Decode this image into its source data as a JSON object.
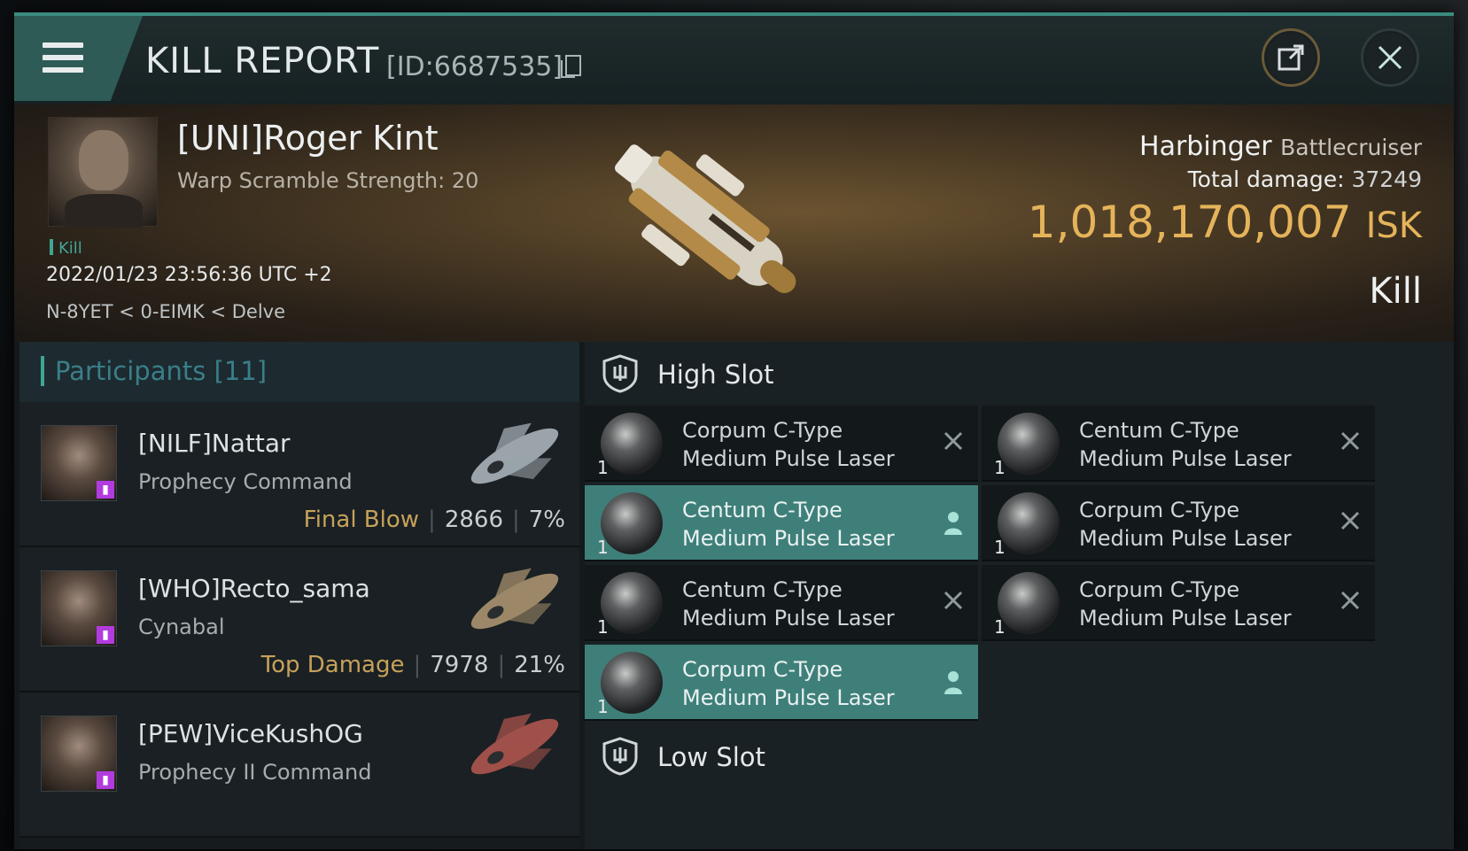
{
  "header": {
    "title": "KILL REPORT",
    "id_label": "[ID:6687535]"
  },
  "victim": {
    "name": "[UNI]Roger Kint",
    "subtitle": "Warp Scramble Strength: 20",
    "kill_tag": "Kill",
    "date": "2022/01/23 23:56:36 UTC +2",
    "location": "N-8YET < 0-EIMK < Delve"
  },
  "ship": {
    "name": "Harbinger",
    "class": "Battlecruiser",
    "total_damage_label": "Total damage:",
    "total_damage": "37249",
    "value": "1,018,170,007",
    "currency": "ISK",
    "result": "Kill"
  },
  "participants": {
    "label": "Participants [11]",
    "rows": [
      {
        "name": "[NILF]Nattar",
        "ship": "Prophecy Command",
        "tag": "Final Blow",
        "damage": "2866",
        "percent": "7%",
        "ship_color": "#9aa4aa"
      },
      {
        "name": "[WHO]Recto_sama",
        "ship": "Cynabal",
        "tag": "Top Damage",
        "damage": "7978",
        "percent": "21%",
        "ship_color": "#9c8868"
      },
      {
        "name": "[PEW]ViceKushOG",
        "ship": "Prophecy II Command",
        "tag": "",
        "damage": "",
        "percent": "",
        "ship_color": "#a0504a"
      }
    ]
  },
  "fitting": {
    "high_slot_label": "High Slot",
    "low_slot_label": "Low Slot",
    "high_slots": [
      {
        "line1": "Corpum C-Type",
        "line2": "Medium Pulse Laser",
        "qty": "1",
        "status": "destroyed"
      },
      {
        "line1": "Centum C-Type",
        "line2": "Medium Pulse Laser",
        "qty": "1",
        "status": "destroyed"
      },
      {
        "line1": "Centum C-Type",
        "line2": "Medium Pulse Laser",
        "qty": "1",
        "status": "dropped"
      },
      {
        "line1": "Corpum C-Type",
        "line2": "Medium Pulse Laser",
        "qty": "1",
        "status": "destroyed"
      },
      {
        "line1": "Centum C-Type",
        "line2": "Medium Pulse Laser",
        "qty": "1",
        "status": "destroyed"
      },
      {
        "line1": "Corpum C-Type",
        "line2": "Medium Pulse Laser",
        "qty": "1",
        "status": "destroyed"
      },
      {
        "line1": "Corpum C-Type",
        "line2": "Medium Pulse Laser",
        "qty": "1",
        "status": "dropped"
      }
    ]
  },
  "icons": {
    "menu": "menu-icon",
    "copy": "copy-icon",
    "share": "share-icon",
    "close": "close-icon",
    "destroyed": "x-icon",
    "dropped": "person-icon"
  },
  "colors": {
    "accent": "#3fa694",
    "isk": "#e5b45a",
    "active_row": "#3f7f7a"
  }
}
